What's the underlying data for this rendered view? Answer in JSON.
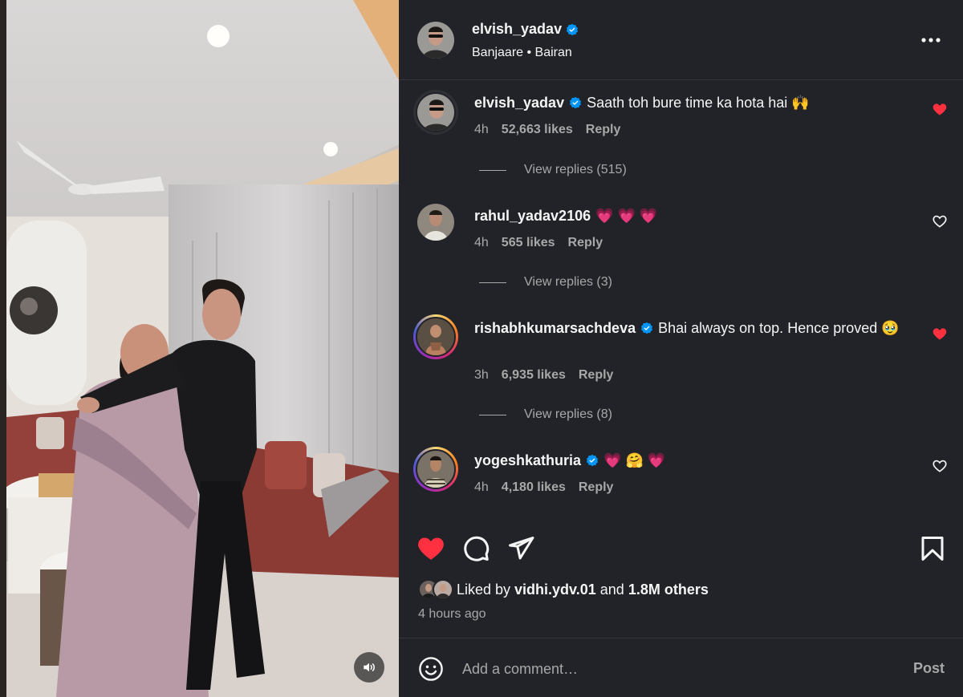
{
  "post": {
    "author": "elvish_yadav",
    "audio": "Banjaare • Bairan",
    "more_icon": "more-horizontal-icon"
  },
  "comments": [
    {
      "username": "elvish_yadav",
      "verified": true,
      "text": "Saath toh bure time ka hota hai 🙌",
      "time": "4h",
      "likes": "52,663 likes",
      "reply": "Reply",
      "view_replies": "View replies (515)",
      "liked": true
    },
    {
      "username": "rahul_yadav2106",
      "verified": false,
      "text": "💗 💗 💗",
      "time": "4h",
      "likes": "565 likes",
      "reply": "Reply",
      "view_replies": "View replies (3)",
      "liked": false
    },
    {
      "username": "rishabhkumarsachdeva",
      "verified": true,
      "text": "Bhai always on top. Hence proved 🥹",
      "time": "3h",
      "likes": "6,935 likes",
      "reply": "Reply",
      "view_replies": "View replies (8)",
      "liked": true
    },
    {
      "username": "yogeshkathuria",
      "verified": true,
      "text": "💗 🤗 💗",
      "time": "4h",
      "likes": "4,180 likes",
      "reply": "Reply",
      "liked": false
    }
  ],
  "footer": {
    "liked_prefix": "Liked by",
    "liked_user": "vidhi.ydv.01",
    "liked_and": "and",
    "liked_others": "1.8M others",
    "timestamp": "4 hours ago",
    "comment_placeholder": "Add a comment…",
    "post_label": "Post"
  },
  "colors": {
    "panel_bg": "#212328",
    "like_red": "#ff3040",
    "verified_blue": "#0095f6",
    "muted_text": "#a8a8a8"
  }
}
